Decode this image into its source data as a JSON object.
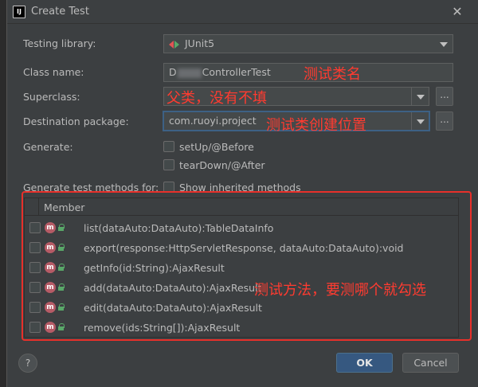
{
  "window": {
    "title": "Create Test",
    "app_icon_text": "IJ"
  },
  "form": {
    "testing_library": {
      "label": "Testing library:",
      "value": "JUnit5"
    },
    "class_name": {
      "label": "Class name:",
      "value_prefix": "D",
      "value_suffix": "ControllerTest"
    },
    "superclass": {
      "label": "Superclass:",
      "value": ""
    },
    "destination_package": {
      "label": "Destination package:",
      "value": "com.ruoyi.project"
    },
    "generate": {
      "label": "Generate:",
      "options": [
        {
          "label": "setUp/@Before",
          "checked": false
        },
        {
          "label": "tearDown/@After",
          "checked": false
        }
      ]
    },
    "methods_for": {
      "label": "Generate test methods for:",
      "show_inherited": {
        "label": "Show inherited methods",
        "checked": false
      }
    }
  },
  "annotations": {
    "class_name_note": "测试类名",
    "superclass_note": "父类，没有不填",
    "package_note": "测试类创建位置",
    "methods_note": "测试方法，要测哪个就勾选"
  },
  "members": {
    "header": "Member",
    "items": [
      {
        "signature": "list(dataAuto:DataAuto):TableDataInfo",
        "checked": false
      },
      {
        "signature": "export(response:HttpServletResponse, dataAuto:DataAuto):void",
        "checked": false
      },
      {
        "signature": "getInfo(id:String):AjaxResult",
        "checked": false
      },
      {
        "signature": "add(dataAuto:DataAuto):AjaxResult",
        "checked": false
      },
      {
        "signature": "edit(dataAuto:DataAuto):AjaxResult",
        "checked": false
      },
      {
        "signature": "remove(ids:String[]):AjaxResult",
        "checked": false
      }
    ]
  },
  "buttons": {
    "ok": "OK",
    "cancel": "Cancel",
    "help": "?",
    "ellipsis": "..."
  },
  "colors": {
    "annotation": "#ff3b30",
    "ok_button": "#365880",
    "dialog_bg": "#3c3f41"
  }
}
